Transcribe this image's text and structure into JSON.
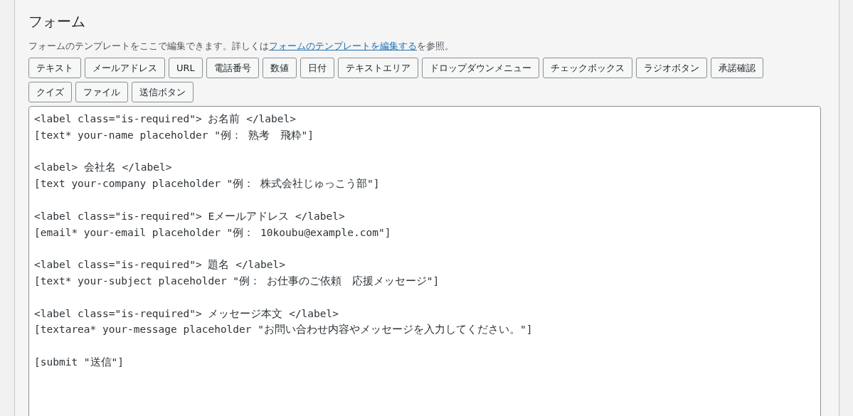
{
  "section": {
    "title": "フォーム",
    "description": {
      "before": "フォームのテンプレートをここで編集できます。詳しくは",
      "link": "フォームのテンプレートを編集する",
      "after": "を参照。"
    },
    "tag_buttons": [
      [
        "テキスト",
        "メールアドレス",
        "URL",
        "電話番号",
        "数値",
        "日付",
        "テキストエリア",
        "ドロップダウンメニュー",
        "チェックボックス",
        "ラジオボタン",
        "承諾確認"
      ],
      [
        "クイズ",
        "ファイル",
        "送信ボタン"
      ]
    ],
    "editor": {
      "blocks": [
        [
          "<label class=\"is-required\"> お名前 </label>",
          "[text* your-name placeholder \"例： 熟考　飛粋\"]"
        ],
        [
          "<label> 会社名 </label>",
          "[text your-company placeholder \"例： 株式会社じゅっこう部\"]"
        ],
        [
          "<label class=\"is-required\"> Eメールアドレス </label>",
          "[email* your-email placeholder \"例： 10koubu@example.com\"]"
        ],
        [
          "<label class=\"is-required\"> 題名 </label>",
          "[text* your-subject placeholder \"例： お仕事のご依頼　応援メッセージ\"]"
        ],
        [
          "<label class=\"is-required\"> メッセージ本文 </label>",
          "[textarea* your-message placeholder \"お問い合わせ内容やメッセージを入力してください。\"]"
        ],
        [
          "[submit \"送信\"]"
        ]
      ]
    }
  }
}
